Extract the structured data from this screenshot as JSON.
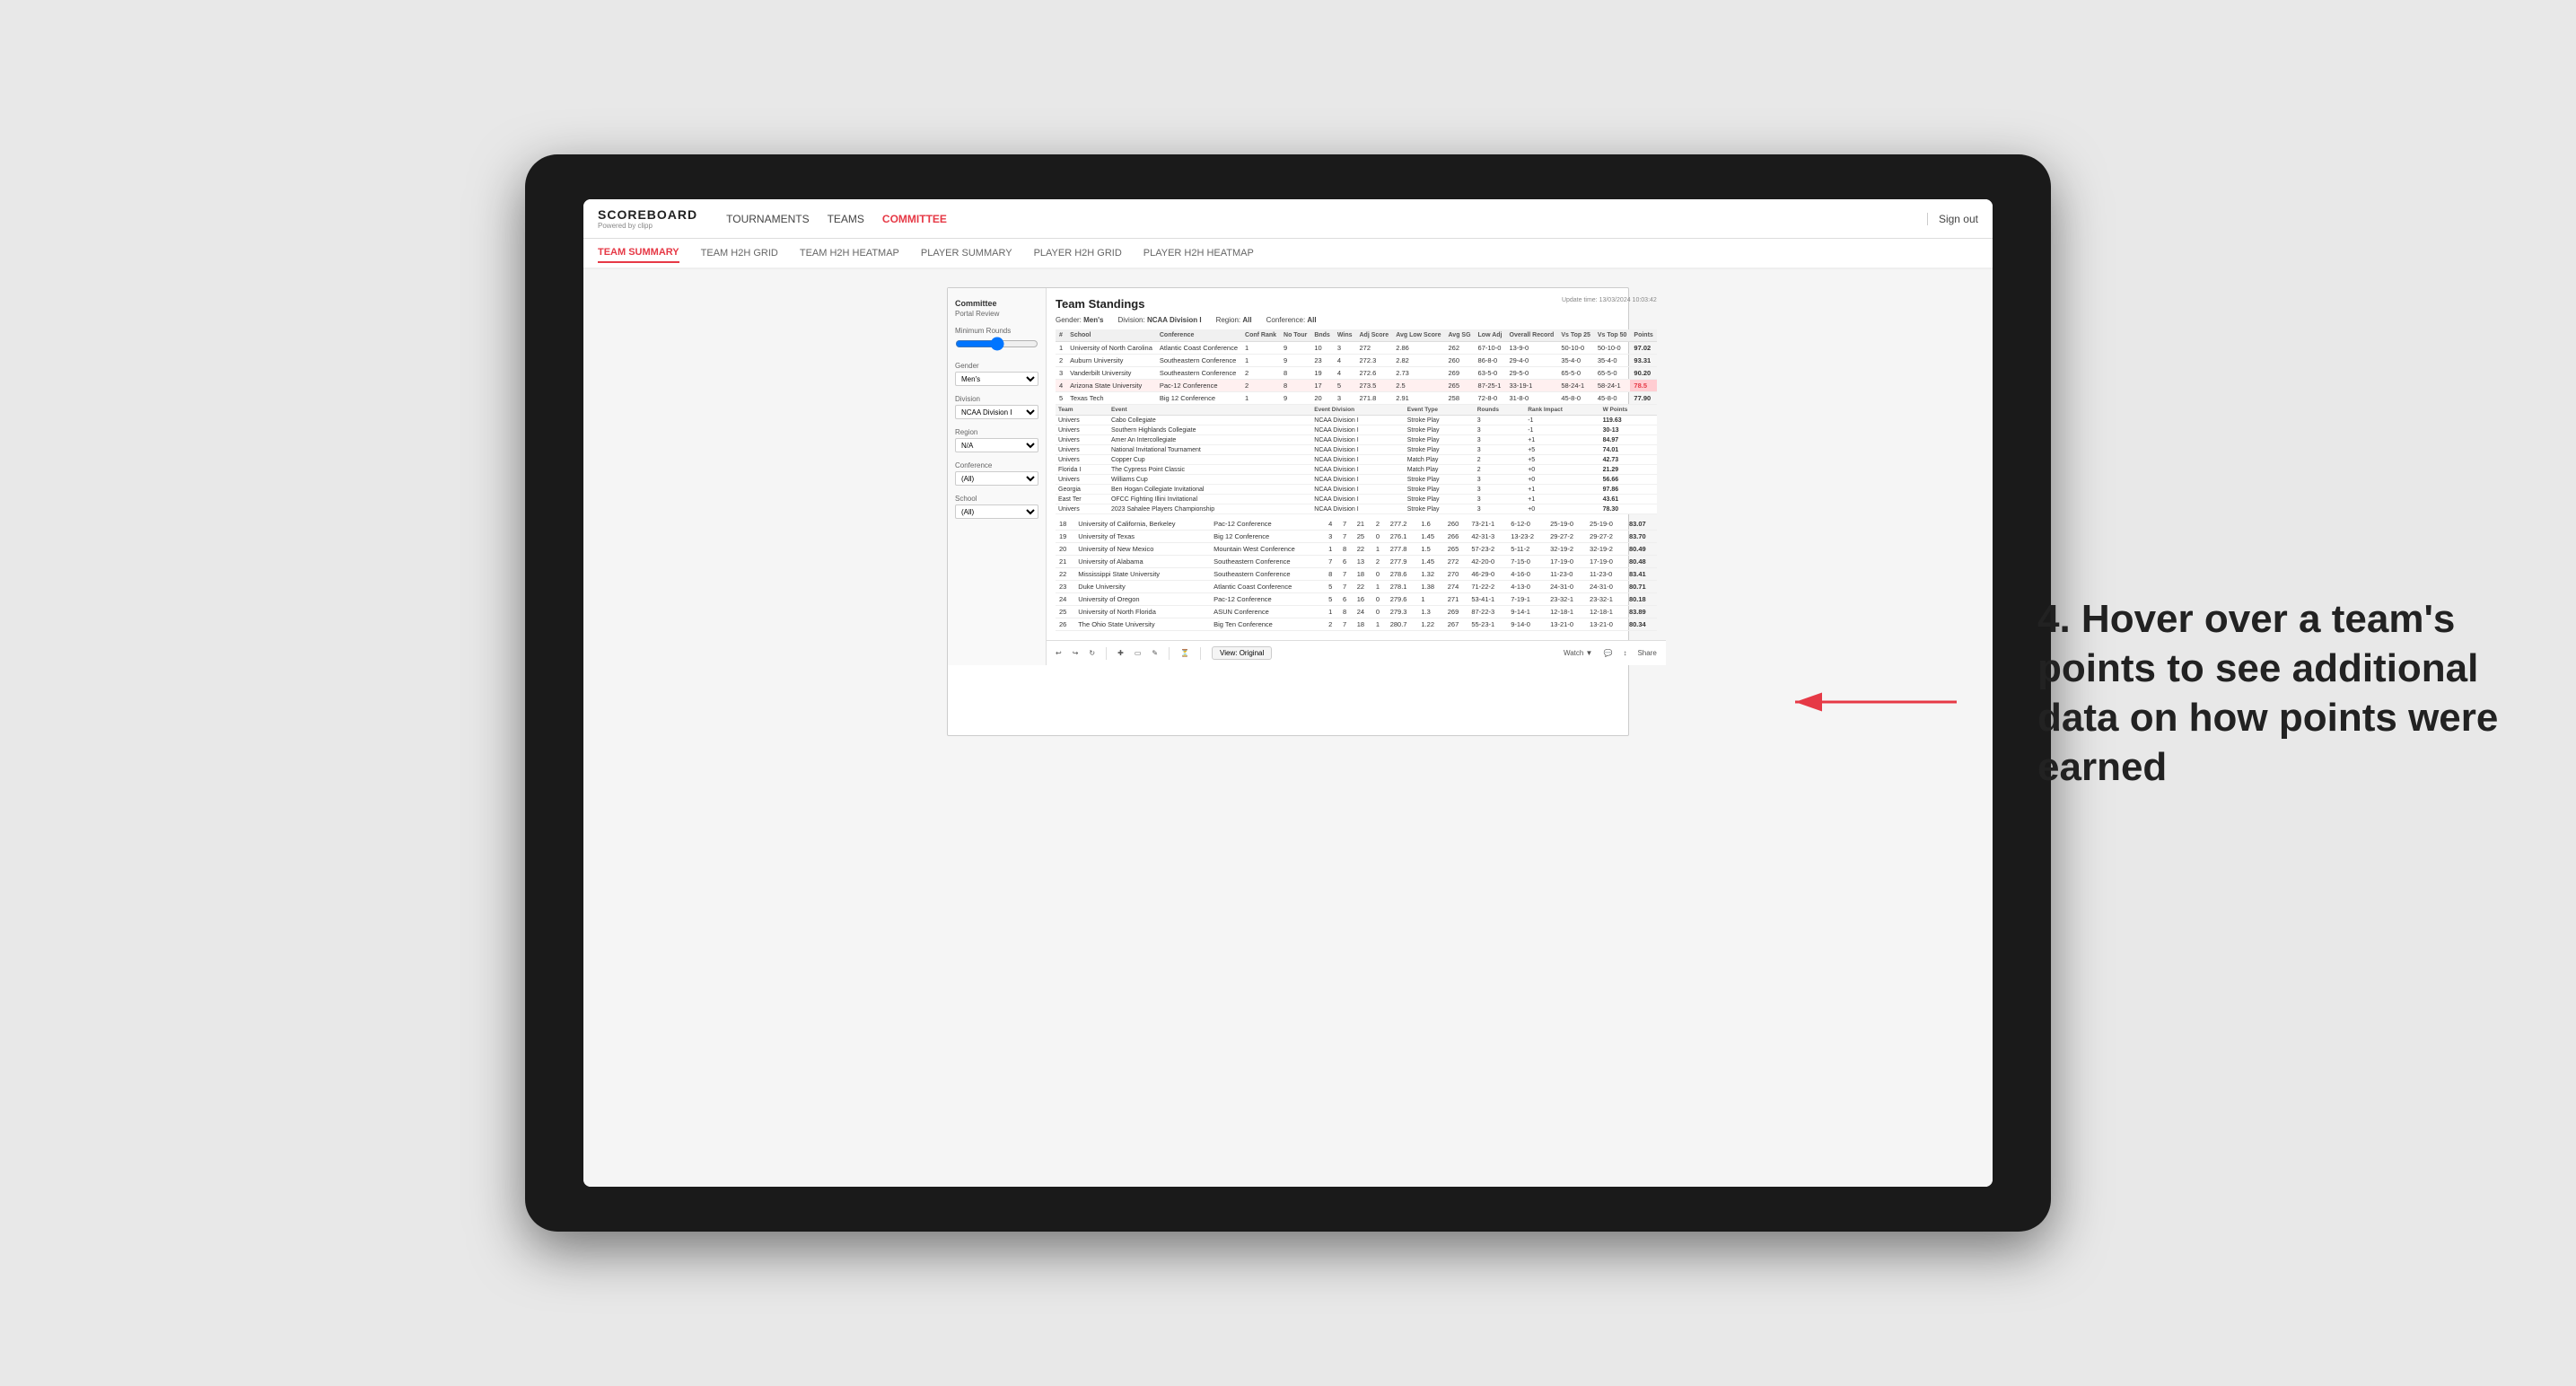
{
  "navbar": {
    "logo": "SCOREBOARD",
    "logo_sub": "Powered by clipp",
    "links": [
      "TOURNAMENTS",
      "TEAMS",
      "COMMITTEE"
    ],
    "active_link": "COMMITTEE",
    "sign_out": "Sign out"
  },
  "subnav": {
    "links": [
      "TEAM SUMMARY",
      "TEAM H2H GRID",
      "TEAM H2H HEATMAP",
      "PLAYER SUMMARY",
      "PLAYER H2H GRID",
      "PLAYER H2H HEATMAP"
    ],
    "active_link": "TEAM SUMMARY"
  },
  "sidebar": {
    "title": "Committee",
    "subtitle": "Portal Review",
    "min_rounds_label": "Minimum Rounds",
    "gender_label": "Gender",
    "gender_value": "Men's",
    "division_label": "Division",
    "division_value": "NCAA Division I",
    "region_label": "Region",
    "region_value": "N/A",
    "conference_label": "Conference",
    "conference_value": "(All)",
    "school_label": "School",
    "school_value": "(All)"
  },
  "report": {
    "title": "Team Standings",
    "update_time": "Update time: 13/03/2024 10:03:42",
    "gender": "Men's",
    "division": "NCAA Division I",
    "region": "All",
    "conference": "All",
    "columns": [
      "#",
      "School",
      "Conference",
      "Conf Rank",
      "No Tour",
      "Bnds",
      "Wins",
      "Adj Score",
      "Avg Low Score",
      "Avg SG",
      "Low Adj",
      "Overall Record",
      "Vs Top 25",
      "Vs Top 50",
      "Points"
    ],
    "rows": [
      {
        "rank": 1,
        "school": "University of North Carolina",
        "conference": "Atlantic Coast Conference",
        "conf_rank": 1,
        "no_tour": 9,
        "bnds": 10,
        "wins": 3,
        "adj_score": 272.0,
        "avg_low": 2.86,
        "avg_sg": 262,
        "low_adj": "67-10-0",
        "overall": "13-9-0",
        "vs25": "50-10-0",
        "vs50": "50-10-0",
        "points": "97.02",
        "highlight": false
      },
      {
        "rank": 2,
        "school": "Auburn University",
        "conference": "Southeastern Conference",
        "conf_rank": 1,
        "no_tour": 9,
        "bnds": 23,
        "wins": 4,
        "adj_score": 272.3,
        "avg_low": 2.82,
        "avg_sg": 260,
        "low_adj": "86-8-0",
        "overall": "29-4-0",
        "vs25": "35-4-0",
        "vs50": "35-4-0",
        "points": "93.31",
        "highlight": false
      },
      {
        "rank": 3,
        "school": "Vanderbilt University",
        "conference": "Southeastern Conference",
        "conf_rank": 2,
        "no_tour": 8,
        "bnds": 19,
        "wins": 4,
        "adj_score": 272.6,
        "avg_low": 2.73,
        "avg_sg": 269,
        "low_adj": "63-5-0",
        "overall": "29-5-0",
        "vs25": "65-5-0",
        "vs50": "65-5-0",
        "points": "90.20",
        "highlight": false
      },
      {
        "rank": 4,
        "school": "Arizona State University",
        "conference": "Pac-12 Conference",
        "conf_rank": 2,
        "no_tour": 8,
        "bnds": 17,
        "wins": 5,
        "adj_score": 273.5,
        "avg_low": 2.5,
        "avg_sg": 265,
        "low_adj": "87-25-1",
        "overall": "33-19-1",
        "vs25": "58-24-1",
        "vs50": "58-24-1",
        "points": "78.5",
        "highlight": true
      },
      {
        "rank": 5,
        "school": "Texas Tech",
        "conference": "Big 12 Conference",
        "conf_rank": 1,
        "no_tour": 9,
        "bnds": 20,
        "wins": 3,
        "adj_score": 271.8,
        "avg_low": 2.91,
        "avg_sg": 258,
        "low_adj": "72-8-0",
        "overall": "31-8-0",
        "vs25": "45-8-0",
        "vs50": "45-8-0",
        "points": "77.90",
        "highlight": false
      }
    ],
    "tooltip_rows": [
      {
        "team": "Univers",
        "event": "Cabo Collegiate",
        "division": "NCAA Division I",
        "type": "Stroke Play",
        "rounds": 3,
        "rank_impact": "-1",
        "points": "119.63"
      },
      {
        "team": "Univers",
        "event": "Southern Highlands Collegiate",
        "division": "NCAA Division I",
        "type": "Stroke Play",
        "rounds": 3,
        "rank_impact": "-1",
        "points": "30-13"
      },
      {
        "team": "Univers",
        "event": "Amer An Intercollegiate",
        "division": "NCAA Division I",
        "type": "Stroke Play",
        "rounds": 3,
        "rank_impact": "+1",
        "points": "84.97"
      },
      {
        "team": "Univers",
        "event": "National Invitational Tournament",
        "division": "NCAA Division I",
        "type": "Stroke Play",
        "rounds": 3,
        "rank_impact": "+5",
        "points": "74.01"
      },
      {
        "team": "Univers",
        "event": "Copper Cup",
        "division": "NCAA Division I",
        "type": "Match Play",
        "rounds": 2,
        "rank_impact": "+5",
        "points": "42.73"
      },
      {
        "team": "Florida I",
        "event": "The Cypress Point Classic",
        "division": "NCAA Division I",
        "type": "Match Play",
        "rounds": 2,
        "rank_impact": "+0",
        "points": "21.29"
      },
      {
        "team": "Univers",
        "event": "Williams Cup",
        "division": "NCAA Division I",
        "type": "Stroke Play",
        "rounds": 3,
        "rank_impact": "+0",
        "points": "56.66"
      },
      {
        "team": "Georgia",
        "event": "Ben Hogan Collegiate Invitational",
        "division": "NCAA Division I",
        "type": "Stroke Play",
        "rounds": 3,
        "rank_impact": "+1",
        "points": "97.86"
      },
      {
        "team": "East Ter",
        "event": "OFCC Fighting Illini Invitational",
        "division": "NCAA Division I",
        "type": "Stroke Play",
        "rounds": 3,
        "rank_impact": "+1",
        "points": "43.61"
      },
      {
        "team": "Univers",
        "event": "2023 Sahalee Players Championship",
        "division": "NCAA Division I",
        "type": "Stroke Play",
        "rounds": 3,
        "rank_impact": "+0",
        "points": "78.30"
      }
    ],
    "lower_rows": [
      {
        "rank": 18,
        "school": "University of California, Berkeley",
        "conference": "Pac-12 Conference",
        "conf_rank": 4,
        "no_tour": 7,
        "bnds": 21,
        "wins": 2,
        "adj_score": 277.2,
        "avg_low": 1.6,
        "avg_sg": 260,
        "low_adj": "73-21-1",
        "overall": "6-12-0",
        "vs25": "25-19-0",
        "vs50": "25-19-0",
        "points": "83.07"
      },
      {
        "rank": 19,
        "school": "University of Texas",
        "conference": "Big 12 Conference",
        "conf_rank": 3,
        "no_tour": 7,
        "bnds": 25,
        "wins": 0,
        "adj_score": 276.1,
        "avg_low": 1.45,
        "avg_sg": 266,
        "low_adj": "42-31-3",
        "overall": "13-23-2",
        "vs25": "29-27-2",
        "vs50": "29-27-2",
        "points": "83.70"
      },
      {
        "rank": 20,
        "school": "University of New Mexico",
        "conference": "Mountain West Conference",
        "conf_rank": 1,
        "no_tour": 8,
        "bnds": 22,
        "wins": 1,
        "adj_score": 277.8,
        "avg_low": 1.5,
        "avg_sg": 265,
        "low_adj": "57-23-2",
        "overall": "5-11-2",
        "vs25": "32-19-2",
        "vs50": "32-19-2",
        "points": "80.49"
      },
      {
        "rank": 21,
        "school": "University of Alabama",
        "conference": "Southeastern Conference",
        "conf_rank": 7,
        "no_tour": 6,
        "bnds": 13,
        "wins": 2,
        "adj_score": 277.9,
        "avg_low": 1.45,
        "avg_sg": 272,
        "low_adj": "42-20-0",
        "overall": "7-15-0",
        "vs25": "17-19-0",
        "vs50": "17-19-0",
        "points": "80.48"
      },
      {
        "rank": 22,
        "school": "Mississippi State University",
        "conference": "Southeastern Conference",
        "conf_rank": 8,
        "no_tour": 7,
        "bnds": 18,
        "wins": 0,
        "adj_score": 278.6,
        "avg_low": 1.32,
        "avg_sg": 270,
        "low_adj": "46-29-0",
        "overall": "4-16-0",
        "vs25": "11-23-0",
        "vs50": "11-23-0",
        "points": "83.41"
      },
      {
        "rank": 23,
        "school": "Duke University",
        "conference": "Atlantic Coast Conference",
        "conf_rank": 5,
        "no_tour": 7,
        "bnds": 22,
        "wins": 1,
        "adj_score": 278.1,
        "avg_low": 1.38,
        "avg_sg": 274,
        "low_adj": "71-22-2",
        "overall": "4-13-0",
        "vs25": "24-31-0",
        "vs50": "24-31-0",
        "points": "80.71"
      },
      {
        "rank": 24,
        "school": "University of Oregon",
        "conference": "Pac-12 Conference",
        "conf_rank": 5,
        "no_tour": 6,
        "bnds": 16,
        "wins": 0,
        "adj_score": 279.6,
        "avg_low": 1.0,
        "avg_sg": 271,
        "low_adj": "53-41-1",
        "overall": "7-19-1",
        "vs25": "23-32-1",
        "vs50": "23-32-1",
        "points": "80.18"
      },
      {
        "rank": 25,
        "school": "University of North Florida",
        "conference": "ASUN Conference",
        "conf_rank": 1,
        "no_tour": 8,
        "bnds": 24,
        "wins": 0,
        "adj_score": 279.3,
        "avg_low": 1.3,
        "avg_sg": 269,
        "low_adj": "87-22-3",
        "overall": "9-14-1",
        "vs25": "12-18-1",
        "vs50": "12-18-1",
        "points": "83.89"
      },
      {
        "rank": 26,
        "school": "The Ohio State University",
        "conference": "Big Ten Conference",
        "conf_rank": 2,
        "no_tour": 7,
        "bnds": 18,
        "wins": 1,
        "adj_score": 280.7,
        "avg_low": 1.22,
        "avg_sg": 267,
        "low_adj": "55-23-1",
        "overall": "9-14-0",
        "vs25": "13-21-0",
        "vs50": "13-21-0",
        "points": "80.34"
      }
    ]
  },
  "annotation": {
    "text": "4. Hover over a team's points to see additional data on how points were earned"
  },
  "toolbar": {
    "undo": "↩",
    "redo": "↪",
    "refresh": "↺",
    "zoom_in": "+",
    "copy": "⧉",
    "pen": "✎",
    "clock": "⏱",
    "view_label": "View: Original",
    "watch_label": "Watch ▼",
    "share_label": "Share"
  }
}
